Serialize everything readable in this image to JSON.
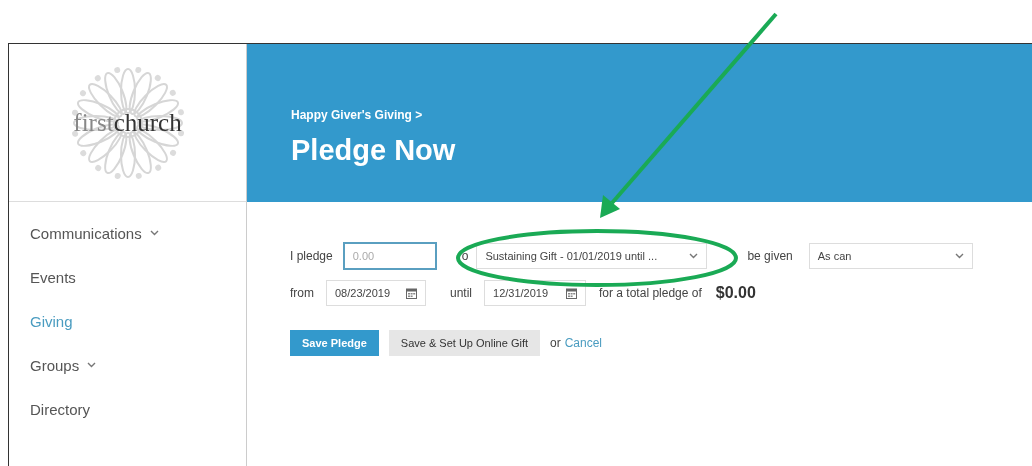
{
  "logo": {
    "text": "first**church**"
  },
  "sidebar": {
    "items": [
      {
        "label": "Communications",
        "expandable": true,
        "selected": false
      },
      {
        "label": "Events",
        "expandable": false,
        "selected": false
      },
      {
        "label": "Giving",
        "expandable": false,
        "selected": true
      },
      {
        "label": "Groups",
        "expandable": true,
        "selected": false
      },
      {
        "label": "Directory",
        "expandable": false,
        "selected": false
      }
    ]
  },
  "header": {
    "breadcrumb": "Happy Giver's Giving >",
    "title": "Pledge Now"
  },
  "form": {
    "pledge_label": "I pledge",
    "amount": {
      "placeholder": "0.00",
      "focused": true
    },
    "to_label": "o",
    "fund": {
      "value": "Sustaining Gift - 01/01/2019 until ..."
    },
    "frequency_label": "be given",
    "frequency": {
      "value": "As can"
    },
    "from_label": "from",
    "from_date": "08/23/2019",
    "until_label": "until",
    "until_date": "12/31/2019",
    "total_label": "for a total pledge of",
    "total": "$0.00"
  },
  "buttons": [
    {
      "label": "Save Pledge",
      "kind": "primary"
    },
    {
      "label": "Save & Set Up Online Gift",
      "kind": "secondary"
    }
  ],
  "or_text": "or",
  "cancel_link": "Cancel"
}
